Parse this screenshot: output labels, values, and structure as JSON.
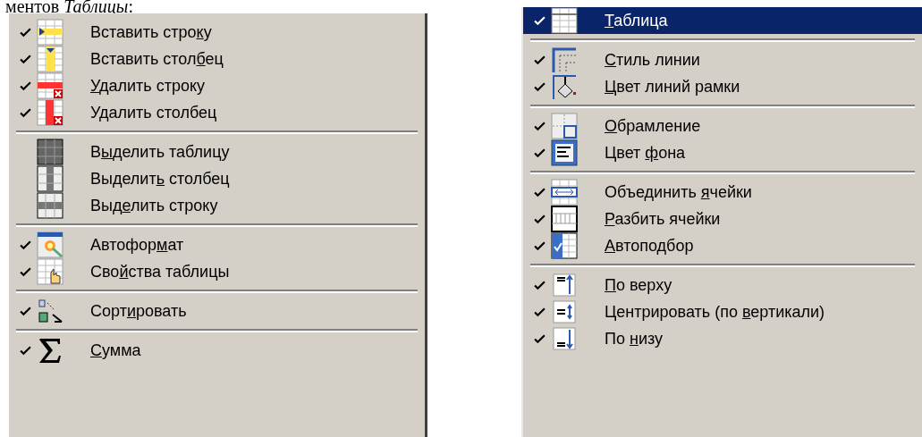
{
  "caption": "ментов *Таблицы*:",
  "menus": [
    {
      "groups": [
        {
          "items": [
            {
              "label": "Вставить строку",
              "checked": true,
              "selected": false
            },
            {
              "label": "Вставить столбец",
              "checked": true,
              "selected": false
            },
            {
              "label": "Удалить строку",
              "checked": true,
              "selected": false
            },
            {
              "label": "Удалить столбец",
              "checked": true,
              "selected": false
            }
          ]
        },
        {
          "items": [
            {
              "label": "Выделить таблицу",
              "checked": false,
              "selected": false
            },
            {
              "label": "Выделить столбец",
              "checked": false,
              "selected": false
            },
            {
              "label": "Выделить строку",
              "checked": false,
              "selected": false
            }
          ]
        },
        {
          "items": [
            {
              "label": "Автоформат",
              "checked": true,
              "selected": false
            },
            {
              "label": "Свойства таблицы",
              "checked": true,
              "selected": false
            }
          ]
        },
        {
          "items": [
            {
              "label": "Сортировать",
              "checked": true,
              "selected": false
            }
          ]
        },
        {
          "items": [
            {
              "label": "Сумма",
              "checked": true,
              "selected": false
            }
          ]
        }
      ]
    },
    {
      "groups": [
        {
          "items": [
            {
              "label": "Таблица",
              "checked": true,
              "selected": true
            }
          ]
        },
        {
          "items": [
            {
              "label": "Стиль линии",
              "checked": true,
              "selected": false
            },
            {
              "label": "Цвет линий рамки",
              "checked": true,
              "selected": false
            }
          ]
        },
        {
          "items": [
            {
              "label": "Обрамление",
              "checked": true,
              "selected": false
            },
            {
              "label": "Цвет фона",
              "checked": true,
              "selected": false
            }
          ]
        },
        {
          "items": [
            {
              "label": "Объединить ячейки",
              "checked": true,
              "selected": false
            },
            {
              "label": "Разбить ячейки",
              "checked": true,
              "selected": false
            },
            {
              "label": "Автоподбор",
              "checked": true,
              "selected": false
            }
          ]
        },
        {
          "items": [
            {
              "label": "По верху",
              "checked": true,
              "selected": false
            },
            {
              "label": "Центрировать (по вертикали)",
              "checked": true,
              "selected": false
            },
            {
              "label": "По низу",
              "checked": true,
              "selected": false
            }
          ]
        }
      ]
    }
  ]
}
